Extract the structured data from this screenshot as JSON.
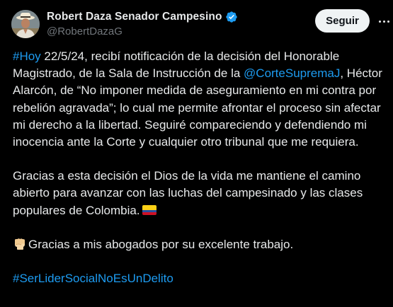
{
  "author": {
    "display_name": "Robert Daza Senador Campesino",
    "handle": "@RobertDazaG",
    "verified_badge_color": "#1d9bf0"
  },
  "actions": {
    "follow_label": "Seguir"
  },
  "tweet": {
    "p1": {
      "hashtag": "#Hoy",
      "t1": " 22/5/24, recibí notificación de la decisión del Honorable Magistrado, de la Sala de Instrucción de la ",
      "mention": "@CorteSupremaJ",
      "t2": ", Héctor Alarcón, de “No imponer medida de aseguramiento en mi contra por rebelión agravada”; lo cual me permite afrontar el proceso sin afectar mi derecho a la libertad. Seguiré compareciendo y defendiendo mi inocencia ante la Corte y cualquier otro tribunal que me requiera."
    },
    "p2": {
      "text": "Gracias a esta decisión el Dios de la vida me mantiene el camino abierto para avanzar con las luchas del campesinado y las clases populares de Colombia."
    },
    "p3": {
      "text": "Gracias a mis abogados por su excelente trabajo."
    },
    "p4": {
      "hashtag": "#SerLiderSocialNoEsUnDelito"
    }
  },
  "colors": {
    "background": "#000000",
    "text": "#e7e9ea",
    "secondary_text": "#71767b",
    "link": "#1d9bf0",
    "button_bg": "#eff3f4"
  },
  "icons": {
    "verified": "verified-badge-icon",
    "flag": "colombia-flag-icon",
    "fist": "raised-fist-icon",
    "more": "more-options-icon"
  }
}
